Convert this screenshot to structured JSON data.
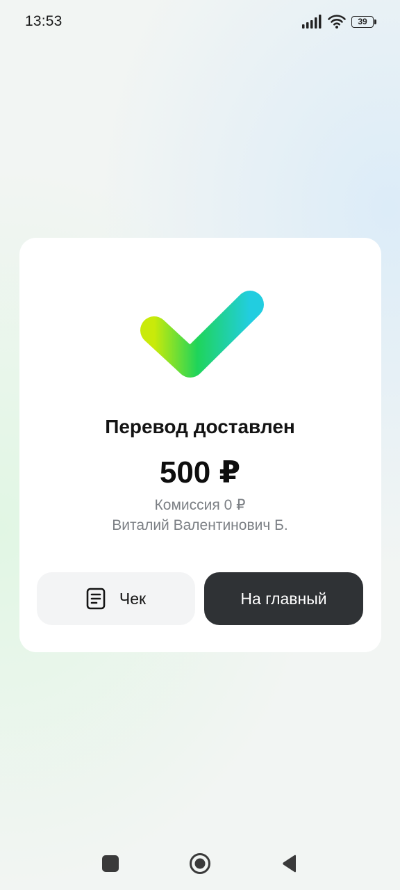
{
  "status_bar": {
    "time": "13:53",
    "battery_level": "39",
    "icons": [
      "signal-icon",
      "wifi-icon",
      "battery-icon"
    ]
  },
  "result": {
    "icon": "checkmark-icon",
    "accent_colors": [
      "#c9ea0a",
      "#1fd45a",
      "#22cde0"
    ],
    "title": "Перевод доставлен",
    "amount": "500 ₽",
    "commission": "Комиссия 0 ₽",
    "recipient": "Виталий Валентинович Б."
  },
  "actions": {
    "receipt_label": "Чек",
    "receipt_icon": "receipt-icon",
    "home_label": "На главный"
  },
  "nav_bar": {
    "icons": [
      "recent-apps-icon",
      "home-icon",
      "back-icon"
    ]
  }
}
